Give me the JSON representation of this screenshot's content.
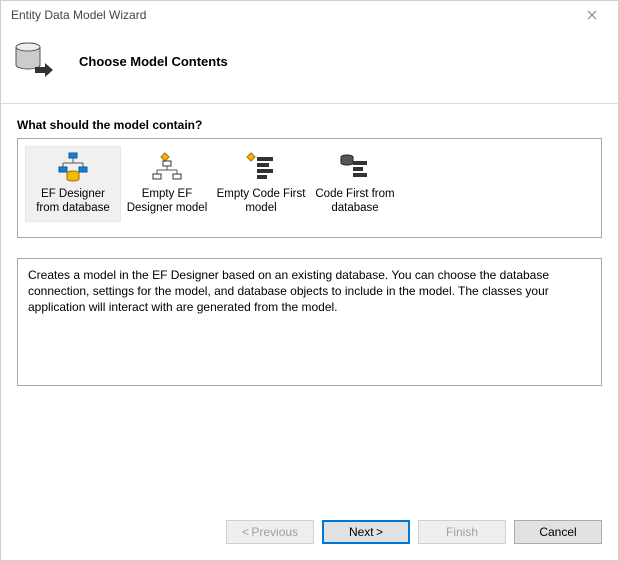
{
  "window": {
    "title": "Entity Data Model Wizard"
  },
  "header": {
    "title": "Choose Model Contents"
  },
  "content": {
    "question": "What should the model contain?",
    "options": [
      {
        "label": "EF Designer from database",
        "selected": true
      },
      {
        "label": "Empty EF Designer model",
        "selected": false
      },
      {
        "label": "Empty Code First model",
        "selected": false
      },
      {
        "label": "Code First from database",
        "selected": false
      }
    ],
    "description": "Creates a model in the EF Designer based on an existing database. You can choose the database connection, settings for the model, and database objects to include in the model. The classes your application will interact with are generated from the model."
  },
  "footer": {
    "previous": "< Previous",
    "next": "Next >",
    "finish": "Finish",
    "cancel": "Cancel"
  }
}
